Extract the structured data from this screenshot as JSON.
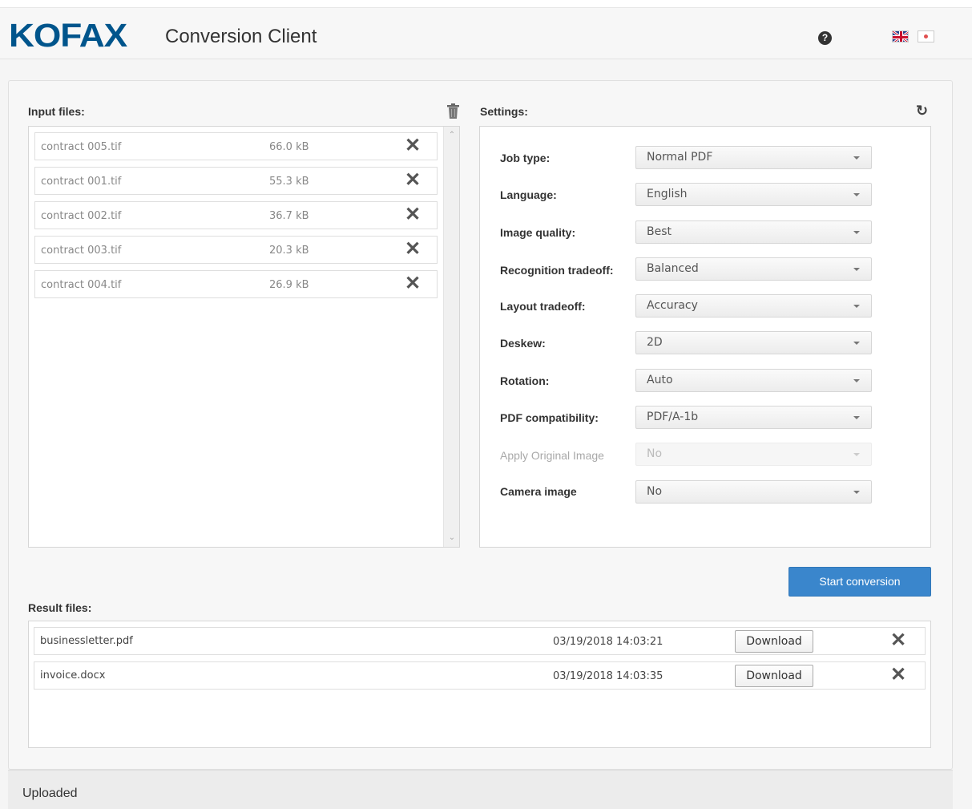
{
  "header": {
    "logo": "KOFAX",
    "title": "Conversion Client",
    "help_icon": "question-circle-icon",
    "languages": [
      "en",
      "ja"
    ]
  },
  "input": {
    "label": "Input files:",
    "files": [
      {
        "name": "contract 005.tif",
        "size": "66.0 kB"
      },
      {
        "name": "contract 001.tif",
        "size": "55.3 kB"
      },
      {
        "name": "contract 002.tif",
        "size": "36.7 kB"
      },
      {
        "name": "contract 003.tif",
        "size": "20.3 kB"
      },
      {
        "name": "contract 004.tif",
        "size": "26.9 kB"
      }
    ]
  },
  "settings": {
    "label": "Settings:",
    "items": [
      {
        "label": "Job type:",
        "value": "Normal PDF"
      },
      {
        "label": "Language:",
        "value": "English"
      },
      {
        "label": "Image quality:",
        "value": "Best"
      },
      {
        "label": "Recognition tradeoff:",
        "value": "Balanced"
      },
      {
        "label": "Layout tradeoff:",
        "value": "Accuracy"
      },
      {
        "label": "Deskew:",
        "value": "2D"
      },
      {
        "label": "Rotation:",
        "value": "Auto"
      },
      {
        "label": "PDF compatibility:",
        "value": "PDF/A-1b"
      },
      {
        "label": "Apply Original Image",
        "value": "No"
      },
      {
        "label": "Camera image",
        "value": "No"
      }
    ]
  },
  "actions": {
    "start": "Start conversion"
  },
  "results": {
    "label": "Result files:",
    "download_label": "Download",
    "files": [
      {
        "name": "businessletter.pdf",
        "date": "03/19/2018 14:03:21"
      },
      {
        "name": "invoice.docx",
        "date": "03/19/2018 14:03:35"
      }
    ]
  },
  "status": {
    "text": "Uploaded"
  },
  "colors": {
    "brand": "#00558c",
    "primary_button": "#3a86cc"
  }
}
